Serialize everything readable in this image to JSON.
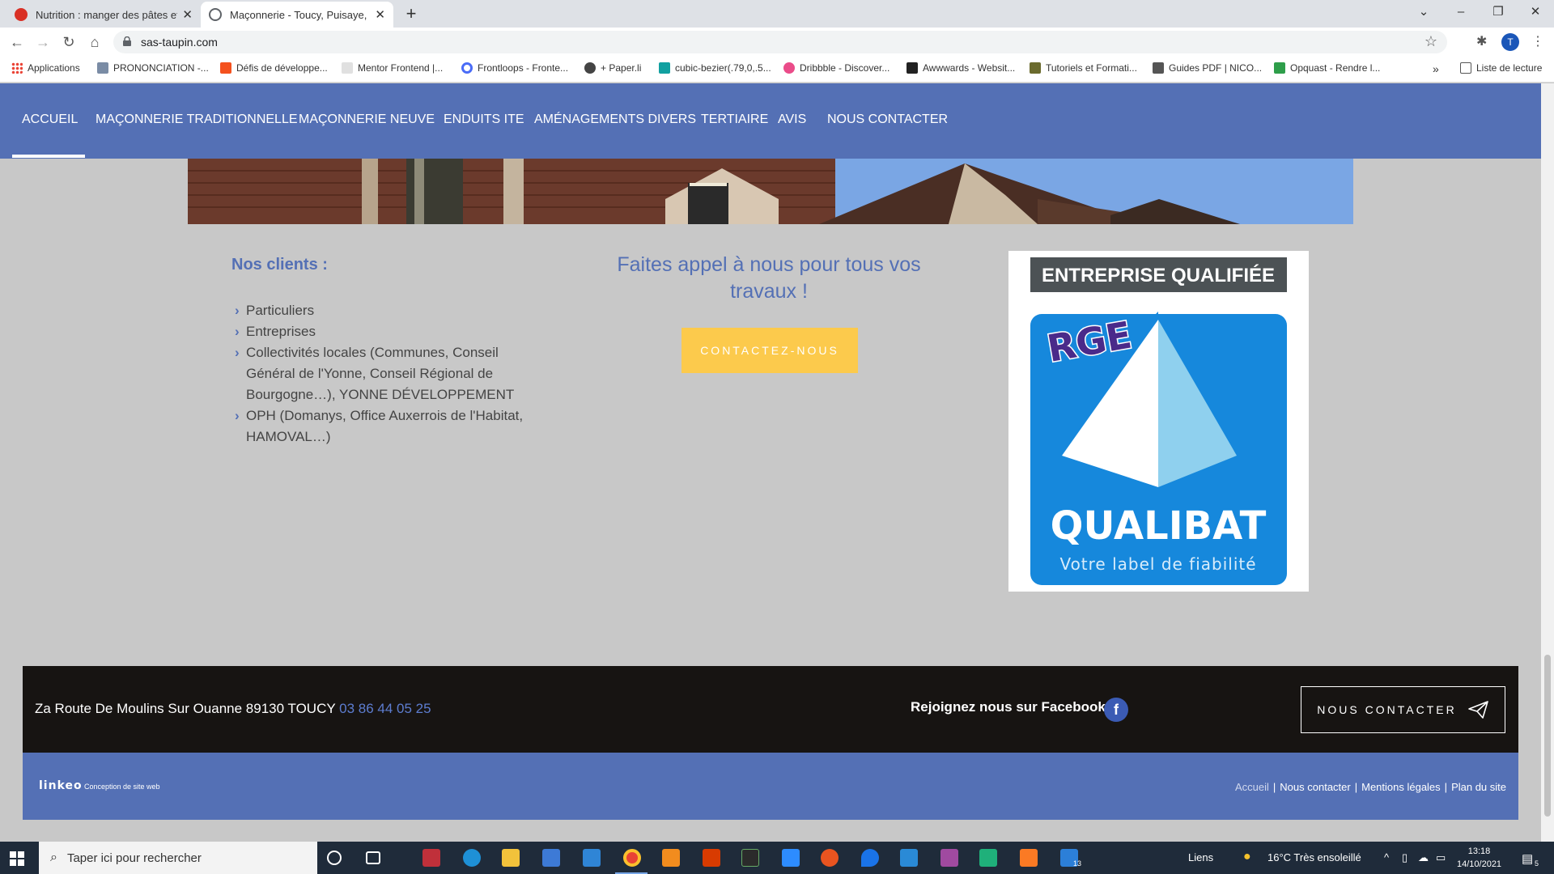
{
  "browser": {
    "tabs": [
      {
        "title": "Nutrition : manger des pâtes et c",
        "favicon_color": "#d93025",
        "active": false
      },
      {
        "title": "Maçonnerie - Toucy, Puisaye, Yon",
        "favicon_color": "#5f6368",
        "active": true
      }
    ],
    "url": "sas-taupin.com",
    "profile_initial": "T",
    "bookmarks": [
      {
        "label": "Applications",
        "icon_color": "#ea4335"
      },
      {
        "label": "PRONONCIATION -...",
        "icon_color": "#7a8ca5"
      },
      {
        "label": "Défis de développe...",
        "icon_color": "#f4511e"
      },
      {
        "label": "Mentor Frontend |...",
        "icon_color": "#c0c0c0"
      },
      {
        "label": "Frontloops - Fronte...",
        "icon_color": "#4a6cf7"
      },
      {
        "label": "+ Paper.li",
        "icon_color": "#444444"
      },
      {
        "label": "cubic-bezier(.79,0,.5...",
        "icon_color": "#11a0a0"
      },
      {
        "label": "Dribbble - Discover...",
        "icon_color": "#ea4c89"
      },
      {
        "label": "Awwwards - Websit...",
        "icon_color": "#222222"
      },
      {
        "label": "Tutoriels et Formati...",
        "icon_color": "#6b6b2e"
      },
      {
        "label": "Guides PDF | NICO...",
        "icon_color": "#555555"
      },
      {
        "label": "Opquast - Rendre l...",
        "icon_color": "#2e9e4a"
      }
    ],
    "reading_list": "Liste de lecture"
  },
  "site": {
    "nav": [
      {
        "label": "ACCUEIL",
        "active": true
      },
      {
        "label": "MAÇONNERIE TRADITIONNELLE",
        "active": false
      },
      {
        "label": "MAÇONNERIE NEUVE",
        "active": false
      },
      {
        "label": "ENDUITS ITE",
        "active": false
      },
      {
        "label": "AMÉNAGEMENTS DIVERS",
        "active": false
      },
      {
        "label": "TERTIAIRE",
        "active": false
      },
      {
        "label": "AVIS",
        "active": false
      },
      {
        "label": "NOUS CONTACTER",
        "active": false
      }
    ],
    "clients": {
      "title": "Nos clients :",
      "items": [
        "Particuliers",
        "Entreprises",
        "Collectivités locales (Communes, Conseil Général de l'Yonne, Conseil Régional de Bourgogne…), YONNE DÉVELOPPEMENT",
        "OPH (Domanys, Office Auxerrois de l'Habitat, HAMOVAL…)"
      ]
    },
    "cta": {
      "text": "Faites appel à nous pour tous vos travaux !",
      "button": "CONTACTEZ-NOUS"
    },
    "badge": {
      "header": "ENTREPRISE QUALIFIÉE",
      "rge": "RGE",
      "brand": "QUALIBAT",
      "tagline": "Votre label de fiabilité"
    },
    "footer": {
      "address": "Za Route De Moulins Sur Ouanne 89130 TOUCY",
      "phone": "03 86 44 05 25",
      "facebook_text": "Rejoignez nous sur Facebook",
      "facebook_icon": "f",
      "contact_button": "NOUS CONTACTER",
      "logo": "linkeo",
      "conception": "Conception de site web",
      "links": [
        "Accueil",
        "Nous contacter",
        "Mentions légales",
        "Plan du site"
      ]
    }
  },
  "taskbar": {
    "search_placeholder": "Taper ici pour rechercher",
    "liens": "Liens",
    "weather": "16°C  Très ensoleillé",
    "time": "13:18",
    "date": "14/10/2021",
    "notif_count": "5",
    "app_badge": "13"
  }
}
